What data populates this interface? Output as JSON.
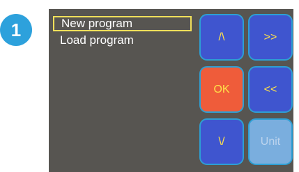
{
  "step_number": "1",
  "menu": {
    "items": [
      "New program",
      "Load program"
    ],
    "selected_index": 0
  },
  "keypad": {
    "up": "/\\",
    "forward": ">>",
    "ok": "OK",
    "back": "<<",
    "down": "\\/",
    "unit": "Unit"
  },
  "colors": {
    "badge": "#2da1dc",
    "screen_bg": "#575551",
    "key_bg": "#3f55cf",
    "key_border": "#2d9fd4",
    "key_text": "#ffe24a",
    "ok_bg": "#ef5c3a",
    "unit_bg": "#7aaede",
    "selection_border": "#f1e05a"
  }
}
